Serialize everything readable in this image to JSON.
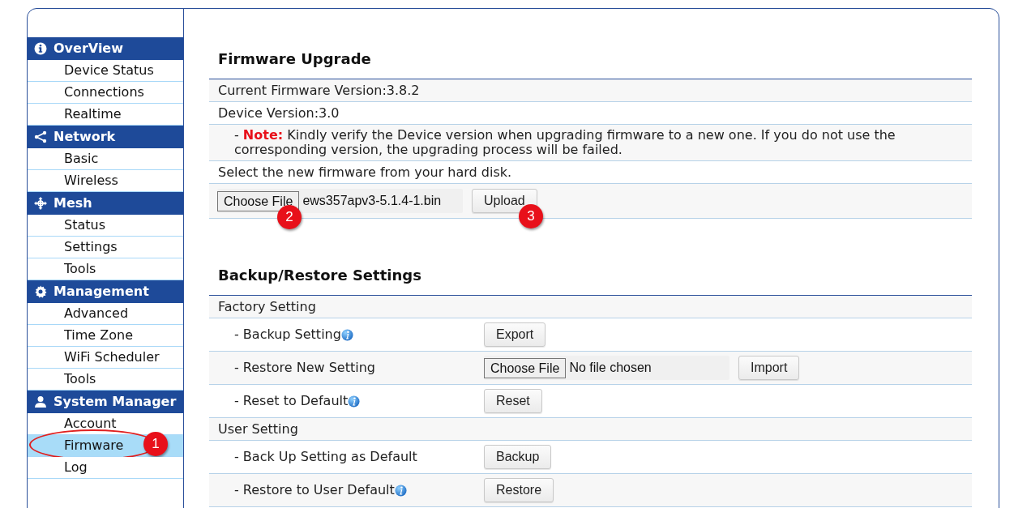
{
  "sidebar": {
    "groups": [
      {
        "title": "OverView",
        "items": [
          {
            "label": "Device Status",
            "selected": false
          },
          {
            "label": "Connections",
            "selected": false
          },
          {
            "label": "Realtime",
            "selected": false
          }
        ]
      },
      {
        "title": "Network",
        "items": [
          {
            "label": "Basic",
            "selected": false
          },
          {
            "label": "Wireless",
            "selected": false
          }
        ]
      },
      {
        "title": "Mesh",
        "items": [
          {
            "label": "Status",
            "selected": false
          },
          {
            "label": "Settings",
            "selected": false
          },
          {
            "label": "Tools",
            "selected": false
          }
        ]
      },
      {
        "title": "Management",
        "items": [
          {
            "label": "Advanced",
            "selected": false
          },
          {
            "label": "Time Zone",
            "selected": false
          },
          {
            "label": "WiFi Scheduler",
            "selected": false
          },
          {
            "label": "Tools",
            "selected": false
          }
        ]
      },
      {
        "title": "System Manager",
        "items": [
          {
            "label": "Account",
            "selected": false
          },
          {
            "label": "Firmware",
            "selected": true,
            "callout": "1"
          },
          {
            "label": "Log",
            "selected": false
          }
        ]
      }
    ]
  },
  "firmware": {
    "title": "Firmware Upgrade",
    "rows": [
      {
        "kind": "text",
        "text": "Current Firmware Version:3.8.2"
      },
      {
        "kind": "text",
        "text": "Device Version:3.0"
      },
      {
        "kind": "note",
        "prefix": "-",
        "label": "Note:",
        "text": "Kindly verify the Device version when upgrading firmware to a new one. If you do not use the corresponding version, the upgrading process will be failed."
      },
      {
        "kind": "text",
        "text": "Select the new firmware from your hard disk."
      },
      {
        "kind": "file",
        "chooser": "Choose File",
        "file": "ews357apv3-5.1.4-1.bin",
        "chooser_callout": "2",
        "button": "Upload",
        "button_callout": "3"
      }
    ]
  },
  "backup": {
    "title": "Backup/Restore Settings",
    "groups": [
      {
        "title": "Factory Setting",
        "rows": [
          {
            "label": "- Backup Setting",
            "info": true,
            "kind": "button",
            "button": "Export"
          },
          {
            "label": "- Restore New Setting",
            "info": false,
            "kind": "file",
            "chooser": "Choose File",
            "file": "No file chosen",
            "button": "Import"
          },
          {
            "label": "- Reset to Default",
            "info": true,
            "kind": "button",
            "button": "Reset"
          }
        ]
      },
      {
        "title": "User Setting",
        "rows": [
          {
            "label": "- Back Up Setting as Default",
            "info": false,
            "kind": "button",
            "button": "Backup"
          },
          {
            "label": "- Restore to User Default",
            "info": true,
            "kind": "button",
            "button": "Restore"
          }
        ]
      }
    ]
  }
}
